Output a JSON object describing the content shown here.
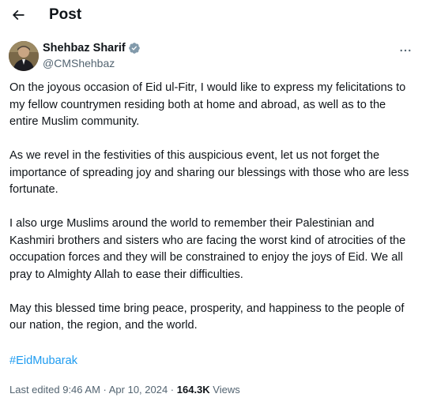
{
  "header": {
    "title": "Post",
    "back_icon": "arrow-left-icon"
  },
  "author": {
    "display_name": "Shehbaz Sharif",
    "handle": "@CMShehbaz",
    "verified_icon": "verified-badge-icon",
    "verified_color": "#829aab"
  },
  "tweet": {
    "paragraphs": [
      "On the joyous occasion of Eid ul-Fitr, I would like to express my felicitations to my fellow countrymen residing both at home and abroad, as well as to the entire Muslim community.",
      "As we revel in the festivities of this auspicious event, let us not forget the importance of spreading joy and sharing our blessings with those who are less fortunate.",
      "I also urge Muslims around the world to remember their Palestinian and Kashmiri brothers and sisters who are facing the worst kind of atrocities of the occupation forces and they will be constrained to enjoy the joys of Eid. We all pray to Almighty Allah to ease their difficulties.",
      "May this blessed time bring peace, prosperity, and happiness to the people of our nation, the region, and the world."
    ],
    "hashtag": "#EidMubarak",
    "hashtag_color": "#1d9bf0"
  },
  "meta": {
    "edited_time": "Last edited 9:46 AM · Apr 10, 2024 · ",
    "views_count": "164.3K",
    "views_label": " Views"
  },
  "more_icon": "more-horizontal-icon"
}
